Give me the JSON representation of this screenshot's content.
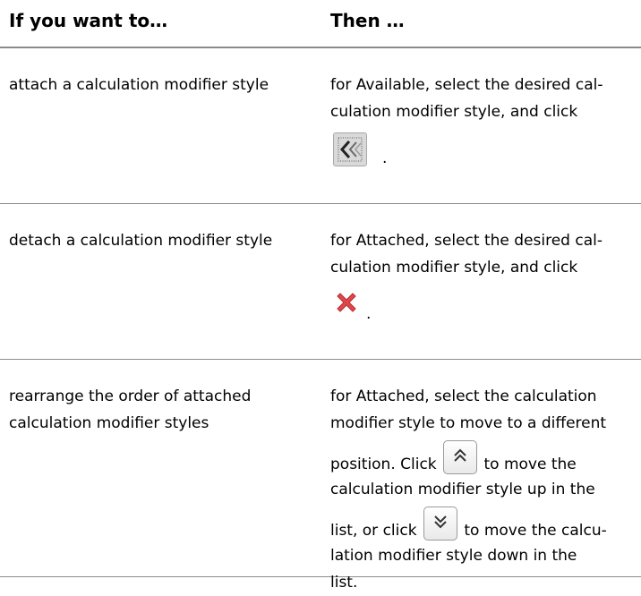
{
  "table": {
    "headers": {
      "col1": "If you want to…",
      "col2": "Then …"
    },
    "rows": [
      {
        "action": "attach a calculation modifier style",
        "instruction_lines": [
          "for Available, select the desired cal-",
          "culation modifier style, and click"
        ],
        "after_icon": "."
      },
      {
        "action": "detach a calculation modifier style",
        "instruction_lines": [
          "for Attached, select the desired cal-",
          "culation modifier style, and click"
        ],
        "after_icon": "."
      },
      {
        "action_lines": [
          "rearrange the order of attached",
          "calculation modifier styles"
        ],
        "instruction": {
          "line1": "for Attached, select the calculation",
          "line2": "modifier style to move to a different",
          "line3_before": "position. Click",
          "line3_after": "to move the",
          "line4": "calculation modifier style up in the",
          "line5_before": "list, or click",
          "line5_after": "to move the calcu-",
          "line6": "lation modifier style down in the",
          "line7": "list."
        }
      }
    ]
  },
  "icons": {
    "attach": "attach-style-icon",
    "detach": "detach-style-icon",
    "move_up": "move-up-icon",
    "move_down": "move-down-icon",
    "detach_color": "#e0474c"
  }
}
